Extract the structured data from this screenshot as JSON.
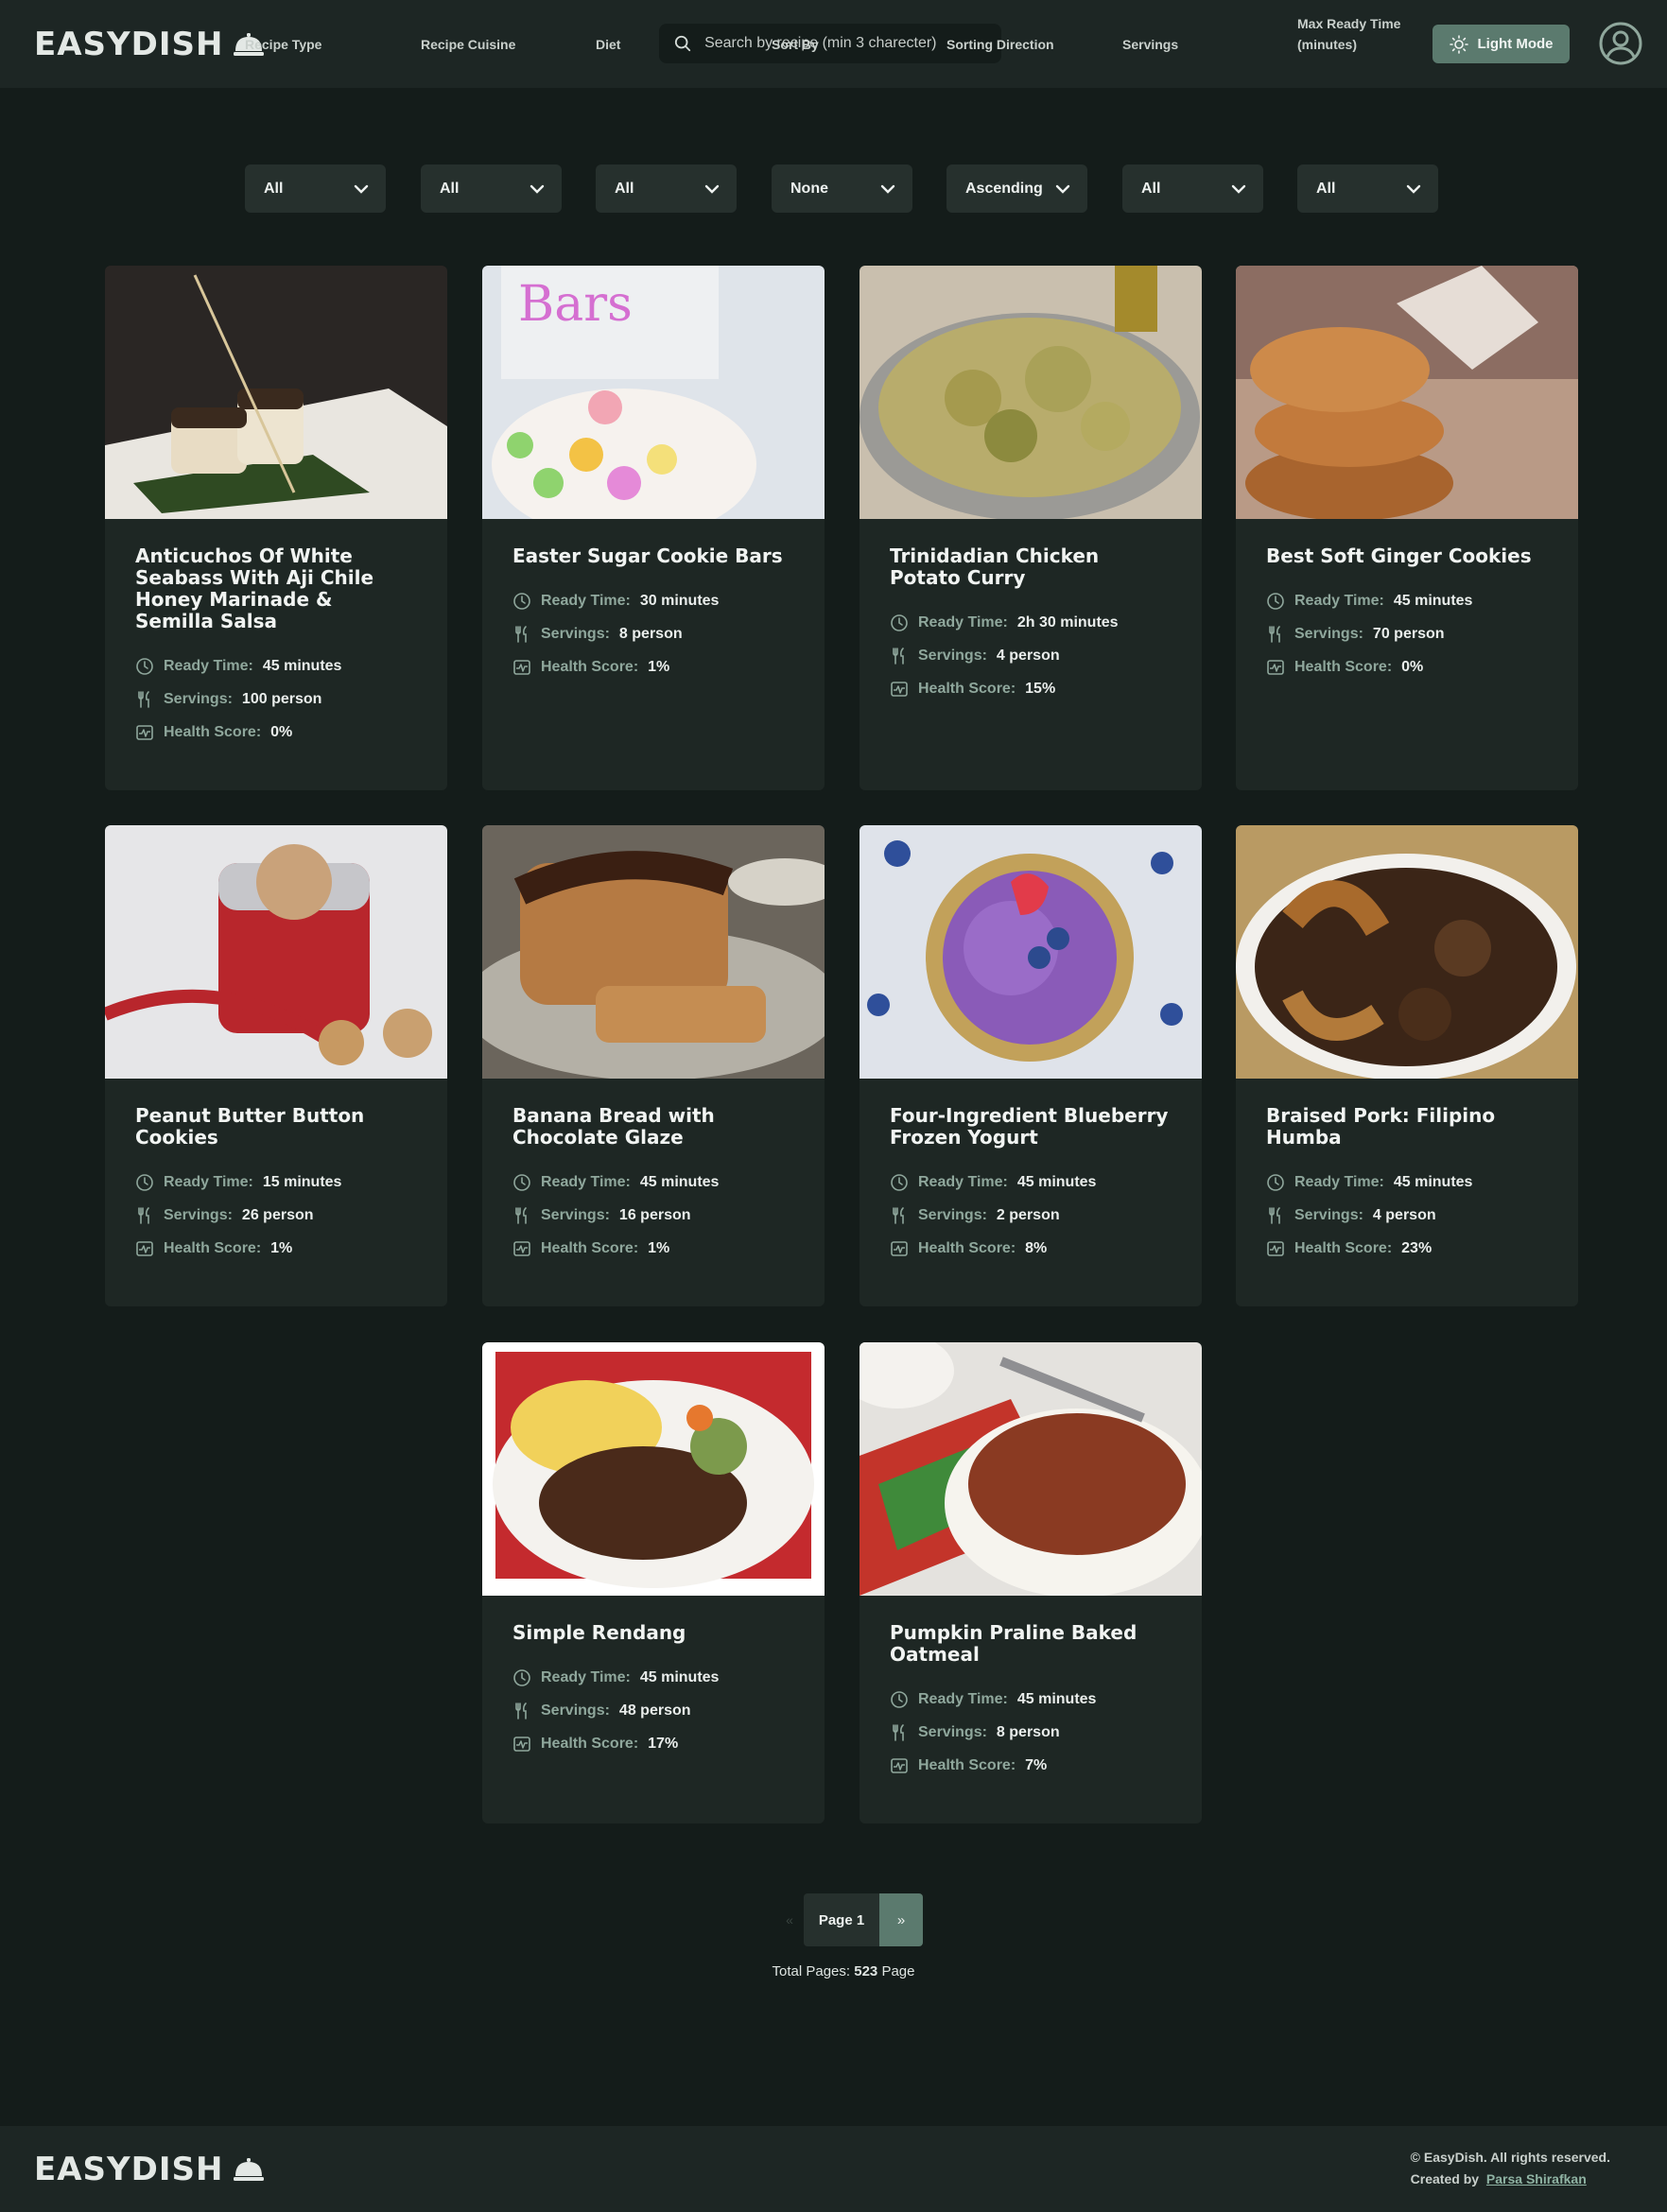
{
  "brand": {
    "name": "EASYDISH"
  },
  "search": {
    "placeholder": "Search by recipe (min 3 charecter)"
  },
  "header": {
    "theme_toggle_label": "Light Mode"
  },
  "filters": [
    {
      "label": "Recipe Type",
      "value": "All"
    },
    {
      "label": "Recipe Cuisine",
      "value": "All"
    },
    {
      "label": "Diet",
      "value": "All"
    },
    {
      "label": "Sort By",
      "value": "None"
    },
    {
      "label": "Sorting Direction",
      "value": "Ascending"
    },
    {
      "label": "Servings",
      "value": "All"
    },
    {
      "label": "Max Ready Time (minutes)",
      "value": "All"
    }
  ],
  "meta_labels": {
    "ready": "Ready Time:",
    "servings": "Servings:",
    "health": "Health Score:"
  },
  "recipes": [
    {
      "title": "Anticuchos Of White Seabass With Aji Chile Honey Marinade & Semilla Salsa",
      "ready": "45 minutes",
      "servings": "100 person",
      "health": "0%"
    },
    {
      "title": "Easter Sugar Cookie Bars",
      "ready": "30 minutes",
      "servings": "8 person",
      "health": "1%"
    },
    {
      "title": "Trinidadian Chicken Potato Curry",
      "ready": "2h 30 minutes",
      "servings": "4 person",
      "health": "15%"
    },
    {
      "title": "Best Soft Ginger Cookies",
      "ready": "45 minutes",
      "servings": "70 person",
      "health": "0%"
    },
    {
      "title": "Peanut Butter Button Cookies",
      "ready": "15 minutes",
      "servings": "26 person",
      "health": "1%"
    },
    {
      "title": "Banana Bread with Chocolate Glaze",
      "ready": "45 minutes",
      "servings": "16 person",
      "health": "1%"
    },
    {
      "title": "Four-Ingredient Blueberry Frozen Yogurt",
      "ready": "45 minutes",
      "servings": "2 person",
      "health": "8%"
    },
    {
      "title": "Braised Pork: Filipino Humba",
      "ready": "45 minutes",
      "servings": "4 person",
      "health": "23%"
    },
    {
      "title": "Simple Rendang",
      "ready": "45 minutes",
      "servings": "48 person",
      "health": "17%"
    },
    {
      "title": "Pumpkin Praline Baked Oatmeal",
      "ready": "45 minutes",
      "servings": "8 person",
      "health": "7%"
    }
  ],
  "pagination": {
    "prev": "«",
    "current": "Page 1",
    "next": "»",
    "total_label": "Total Pages:",
    "total_value": "523",
    "total_unit": "Page"
  },
  "footer": {
    "brand": "EASYDISH",
    "copyright": "© EasyDish. All rights reserved.",
    "created_by": "Created by",
    "author": "Parsa Shirafkan"
  },
  "colors": {
    "accent": "#5b7a6e",
    "background": "#141c1a",
    "card": "#1e2724"
  }
}
